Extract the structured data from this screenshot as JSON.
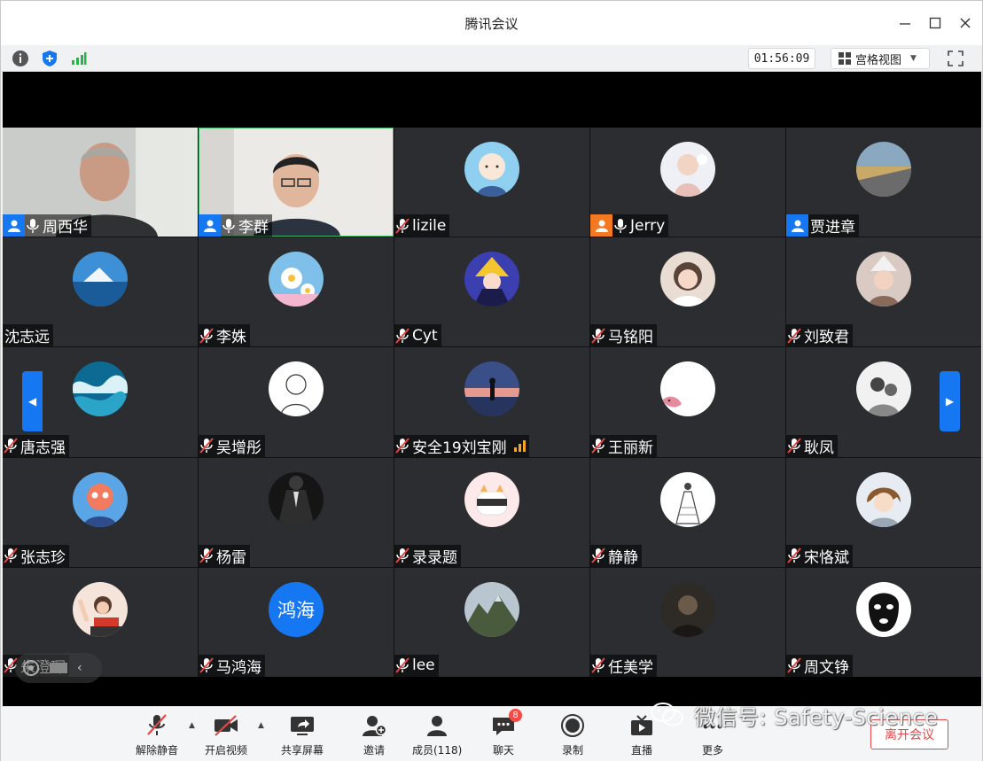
{
  "window": {
    "title": "腾讯会议"
  },
  "infobar": {
    "timer": "01:56:09",
    "view_label": "宫格视图"
  },
  "participants": [
    {
      "name": "周西华",
      "type": "video",
      "host": "blue",
      "mic": "on"
    },
    {
      "name": "李群",
      "type": "video",
      "host": "blue",
      "mic": "on",
      "speaking": true
    },
    {
      "name": "lizile",
      "type": "avatar",
      "mic": "muted",
      "avatar_icon": "bald-cartoon-avatar"
    },
    {
      "name": "Jerry",
      "type": "avatar",
      "host": "orange",
      "mic": "on",
      "avatar_icon": "baby-photo-avatar"
    },
    {
      "name": "贾进章",
      "type": "avatar",
      "host": "blue",
      "avatar_icon": "landscape-photo-avatar"
    },
    {
      "name": "沈志远",
      "type": "avatar",
      "avatar_icon": "mountain-sea-avatar"
    },
    {
      "name": "李姝",
      "type": "avatar",
      "mic": "muted",
      "avatar_icon": "daisy-flower-avatar"
    },
    {
      "name": "Cyt",
      "type": "avatar",
      "mic": "muted",
      "avatar_icon": "anime-character-avatar"
    },
    {
      "name": "马铭阳",
      "type": "avatar",
      "mic": "muted",
      "avatar_icon": "girl-portrait-avatar"
    },
    {
      "name": "刘致君",
      "type": "avatar",
      "mic": "muted",
      "avatar_icon": "girl-hat-avatar"
    },
    {
      "name": "唐志强",
      "type": "avatar",
      "mic": "muted",
      "avatar_icon": "ocean-wave-avatar"
    },
    {
      "name": "吴增彤",
      "type": "avatar",
      "mic": "muted",
      "avatar_icon": "line-drawing-avatar"
    },
    {
      "name": "安全19刘宝刚",
      "type": "avatar",
      "mic": "muted",
      "signal": true,
      "avatar_icon": "sunset-silhouette-avatar"
    },
    {
      "name": "王丽新",
      "type": "avatar",
      "mic": "muted",
      "avatar_icon": "pink-bird-avatar"
    },
    {
      "name": "耿凤",
      "type": "avatar",
      "mic": "muted",
      "avatar_icon": "couple-sketch-avatar"
    },
    {
      "name": "张志珍",
      "type": "avatar",
      "mic": "muted",
      "avatar_icon": "cartoon-toy-avatar"
    },
    {
      "name": "杨雷",
      "type": "avatar",
      "mic": "muted",
      "avatar_icon": "suit-man-avatar"
    },
    {
      "name": "录录题",
      "type": "avatar",
      "mic": "muted",
      "avatar_icon": "cat-sushi-avatar"
    },
    {
      "name": "静静",
      "type": "avatar",
      "mic": "muted",
      "avatar_icon": "dress-sketch-avatar"
    },
    {
      "name": "宋恪斌",
      "type": "avatar",
      "mic": "muted",
      "avatar_icon": "anime-boy-avatar"
    },
    {
      "name": "朱澄琛",
      "type": "avatar",
      "mic": "muted",
      "avatar_icon": "cheering-girl-avatar"
    },
    {
      "name": "马鸿海",
      "type": "avatar",
      "mic": "muted",
      "avatar_text": "鸿海"
    },
    {
      "name": "lee",
      "type": "avatar",
      "mic": "muted",
      "avatar_icon": "mountain-peak-avatar"
    },
    {
      "name": "任美学",
      "type": "avatar",
      "mic": "muted",
      "avatar_icon": "dark-portrait-avatar"
    },
    {
      "name": "周文铮",
      "type": "avatar",
      "mic": "muted",
      "avatar_icon": "masked-face-avatar"
    }
  ],
  "toolbar": {
    "unmute": "解除静音",
    "video": "开启视频",
    "share": "共享屏幕",
    "invite": "邀请",
    "members": "成员(118)",
    "chat": "聊天",
    "chat_badge": "8",
    "record": "录制",
    "live": "直播",
    "more": "更多",
    "leave": "离开会议"
  },
  "watermark": {
    "text": "微信号: Safety-Science"
  },
  "colors": {
    "accent": "#1677f2",
    "host_orange": "#f37a22",
    "leave_red": "#e54545",
    "tile_bg": "#2b2d31"
  }
}
